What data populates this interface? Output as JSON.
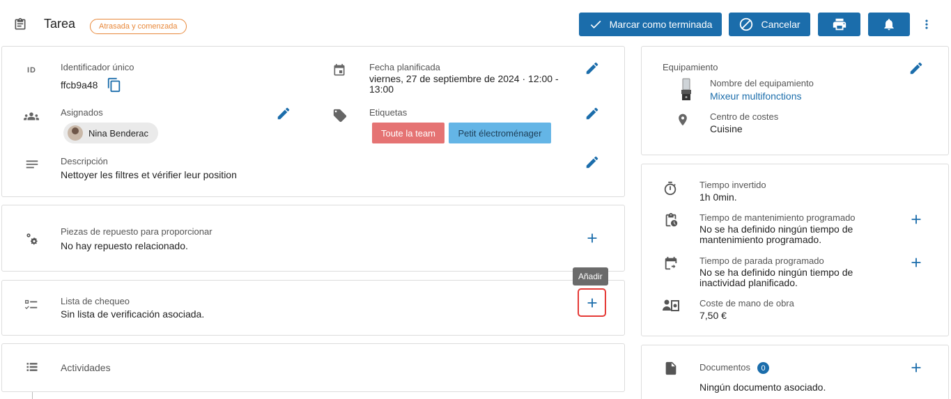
{
  "header": {
    "title": "Tarea",
    "status_badge": "Atrasada y comenzada",
    "mark_done_label": "Marcar como terminada",
    "cancel_label": "Cancelar"
  },
  "details": {
    "id_icon_text": "ID",
    "unique_id_label": "Identificador único",
    "unique_id_value": "ffcb9a48",
    "planned_date_label": "Fecha planificada",
    "planned_date_value": "viernes, 27 de septiembre de 2024 · 12:00 - 13:00",
    "assigned_label": "Asignados",
    "assignee_name": "Nina Benderac",
    "tags_label": "Etiquetas",
    "tags": [
      "Toute la team",
      "Petit électroménager"
    ],
    "description_label": "Descripción",
    "description_value": "Nettoyer les filtres et vérifier leur position"
  },
  "spare_parts": {
    "label": "Piezas de repuesto para proporcionar",
    "value": "No hay repuesto relacionado."
  },
  "checklist": {
    "label": "Lista de chequeo",
    "value": "Sin lista de verificación asociada.",
    "tooltip": "Añadir"
  },
  "activities": {
    "label": "Actividades"
  },
  "equipment": {
    "title": "Equipamiento",
    "name_label": "Nombre del equipamiento",
    "name_value": "Mixeur multifonctions",
    "cost_center_label": "Centro de costes",
    "cost_center_value": "Cuisine"
  },
  "time": {
    "spent_label": "Tiempo invertido",
    "spent_value": "1h 0min.",
    "maintenance_label": "Tiempo de mantenimiento programado",
    "maintenance_value": "No se ha definido ningún tiempo de mantenimiento programado.",
    "downtime_label": "Tiempo de parada programado",
    "downtime_value": "No se ha definido ningún tiempo de inactividad planificado.",
    "labor_cost_label": "Coste de mano de obra",
    "labor_cost_value": "7,50 €"
  },
  "documents": {
    "label": "Documentos",
    "count": "0",
    "value": "Ningún documento asociado."
  },
  "icons": {
    "clipboard": "clipboard-icon",
    "check": "check-icon",
    "cancel": "cancel-circle-icon",
    "print": "print-icon",
    "bell": "bell-icon",
    "more": "more-vert-icon",
    "copy": "copy-icon",
    "calendar": "calendar-icon",
    "group": "group-icon",
    "tag": "tag-icon",
    "notes": "notes-icon",
    "edit": "pencil-icon",
    "gears": "gears-icon",
    "checklist": "checklist-icon",
    "list": "list-icon",
    "pin": "location-pin-icon",
    "timer": "timer-icon",
    "plus": "plus-icon",
    "document": "document-icon"
  },
  "colors": {
    "primary": "#1b6dab",
    "badge_orange": "#e8883a",
    "tag_red": "#e57373",
    "tag_blue": "#64b5e6",
    "highlight_red": "#e53935"
  }
}
